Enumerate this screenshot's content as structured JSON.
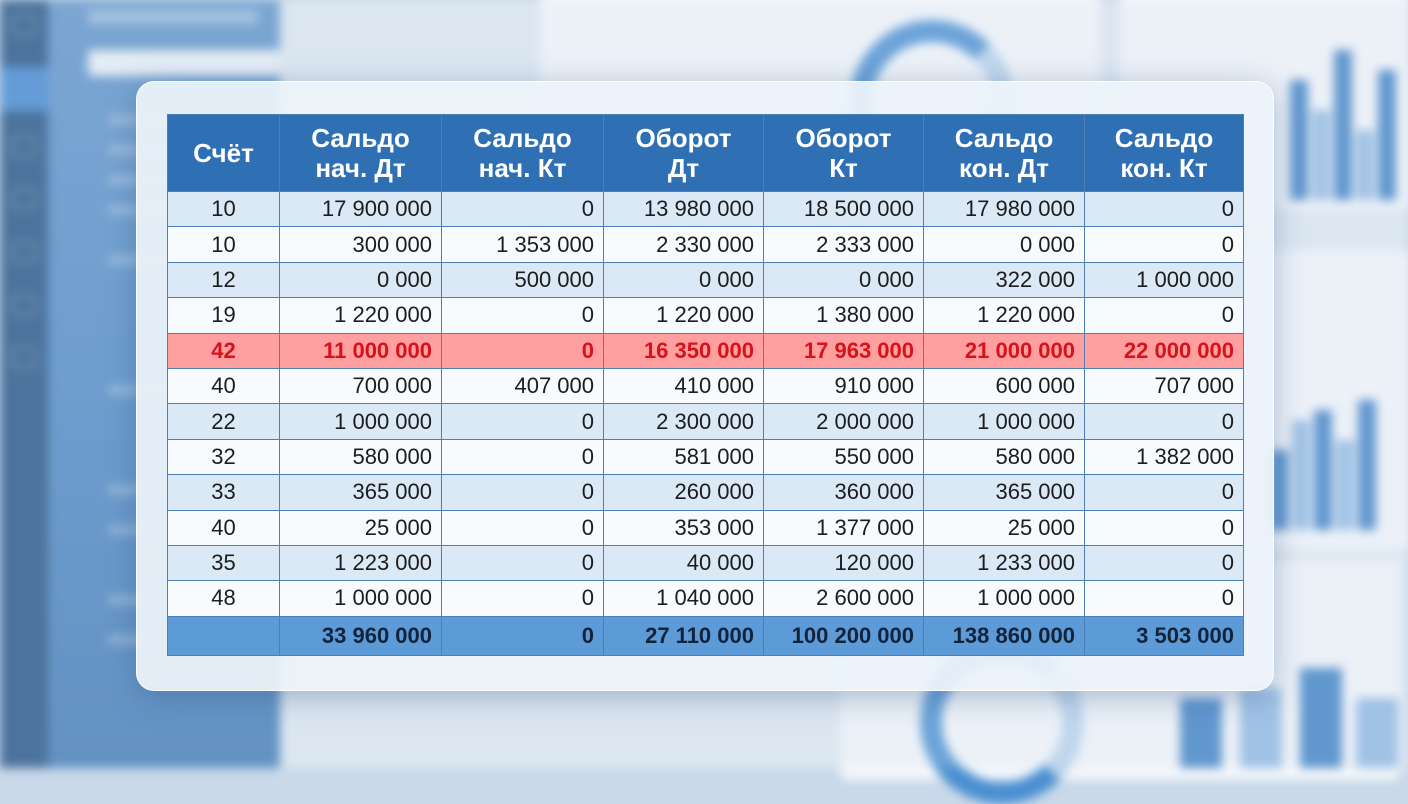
{
  "table": {
    "headers": [
      [
        "Счёт"
      ],
      [
        "Сальдо",
        "нач. Дт"
      ],
      [
        "Сальдо",
        "нач. Кт"
      ],
      [
        "Оборот",
        "Дт"
      ],
      [
        "Оборот",
        "Кт"
      ],
      [
        "Сальдо",
        "кон. Дт"
      ],
      [
        "Сальдо",
        "кон. Кт"
      ]
    ],
    "rows": [
      [
        "10",
        "17 900 000",
        "0",
        "13 980 000",
        "18 500 000",
        "17 980 000",
        "0"
      ],
      [
        "10",
        "300 000",
        "1 353 000",
        "2 330 000",
        "2 333 000",
        "0 000",
        "0"
      ],
      [
        "12",
        "0 000",
        "500 000",
        "0 000",
        "0 000",
        "322 000",
        "1 000 000"
      ],
      [
        "19",
        "1 220 000",
        "0",
        "1 220 000",
        "1 380 000",
        "1 220 000",
        "0"
      ],
      [
        "42",
        "11 000 000",
        "0",
        "16 350 000",
        "17 963 000",
        "21 000 000",
        "22 000 000"
      ],
      [
        "40",
        "700 000",
        "407 000",
        "410 000",
        "910 000",
        "600 000",
        "707 000"
      ],
      [
        "22",
        "1 000 000",
        "0",
        "2 300 000",
        "2 000 000",
        "1 000 000",
        "0"
      ],
      [
        "32",
        "580 000",
        "0",
        "581 000",
        "550 000",
        "580 000",
        "1 382 000"
      ],
      [
        "33",
        "365 000",
        "0",
        "260 000",
        "360 000",
        "365 000",
        "0"
      ],
      [
        "40",
        "25 000",
        "0",
        "353 000",
        "1 377 000",
        "25 000",
        "0"
      ],
      [
        "35",
        "1 223 000",
        "0",
        "40 000",
        "120 000",
        "1 233 000",
        "0"
      ],
      [
        "48",
        "1 000 000",
        "0",
        "1 040 000",
        "2 600 000",
        "1 000 000",
        "0"
      ]
    ],
    "highlight_row": 4,
    "totals": [
      "",
      "33 960 000",
      "0",
      "27 110 000",
      "100 200 000",
      "138 860 000",
      "3 503 000"
    ]
  },
  "colors": {
    "header_bg": "#2f6fb3",
    "highlight_bg": "#ff9f9f",
    "highlight_text": "#d6121b",
    "total_bg": "#5d9ad8"
  }
}
